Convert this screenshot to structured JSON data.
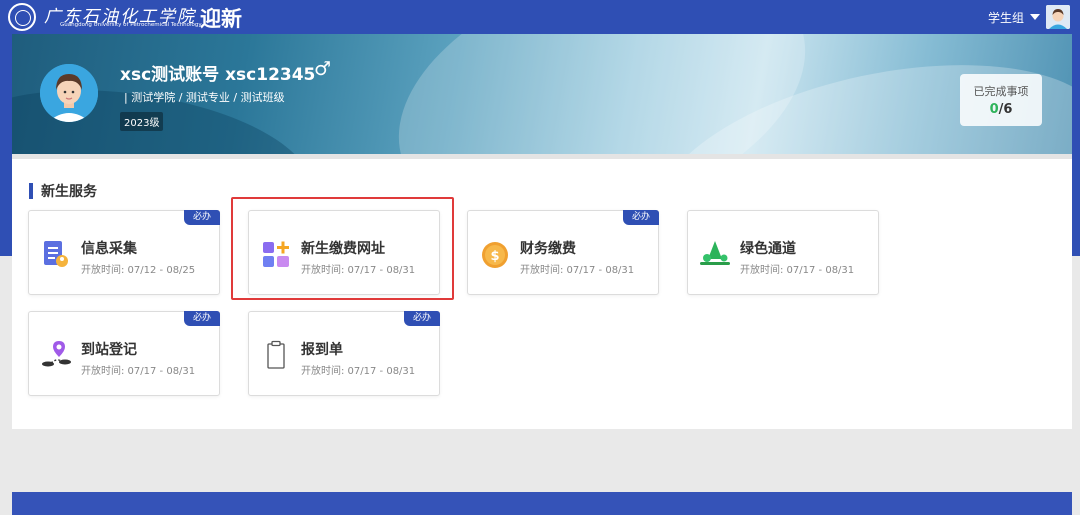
{
  "topbar": {
    "school_cn": "广东石油化工学院",
    "school_en": "Guangdong University of Petrochemical Technology",
    "app_title": "迎新",
    "user_group": "学生组",
    "caret_icon": "caret-down-icon",
    "avatar_icon": "user-avatar-icon"
  },
  "hero": {
    "name_line": "xsc测试账号  xsc12345",
    "gender_symbol": "♂",
    "org_path": "| 测试学院 / 测试专业 / 测试班级",
    "grade": "2023级",
    "progress_label": "已完成事项",
    "progress_done": "0",
    "progress_sep": "/",
    "progress_total": "6"
  },
  "section": {
    "title": "新生服务"
  },
  "cards": [
    {
      "title": "信息采集",
      "time": "开放时间: 07/12 - 08/25",
      "badge": "必办",
      "icon": "info-collect-icon"
    },
    {
      "title": "新生缴费网址",
      "time": "开放时间: 07/17 - 08/31",
      "badge": "",
      "icon": "payment-url-icon"
    },
    {
      "title": "财务缴费",
      "time": "开放时间: 07/17 - 08/31",
      "badge": "必办",
      "icon": "coin-icon"
    },
    {
      "title": "绿色通道",
      "time": "开放时间: 07/17 - 08/31",
      "badge": "",
      "icon": "green-channel-icon"
    },
    {
      "title": "到站登记",
      "time": "开放时间: 07/17 - 08/31",
      "badge": "必办",
      "icon": "location-pin-icon"
    },
    {
      "title": "报到单",
      "time": "开放时间: 07/17 - 08/31",
      "badge": "必办",
      "icon": "clipboard-icon"
    }
  ],
  "colors": {
    "brand": "#2f4fb4",
    "done": "#2fb35b",
    "highlight": "#e03a3a"
  }
}
